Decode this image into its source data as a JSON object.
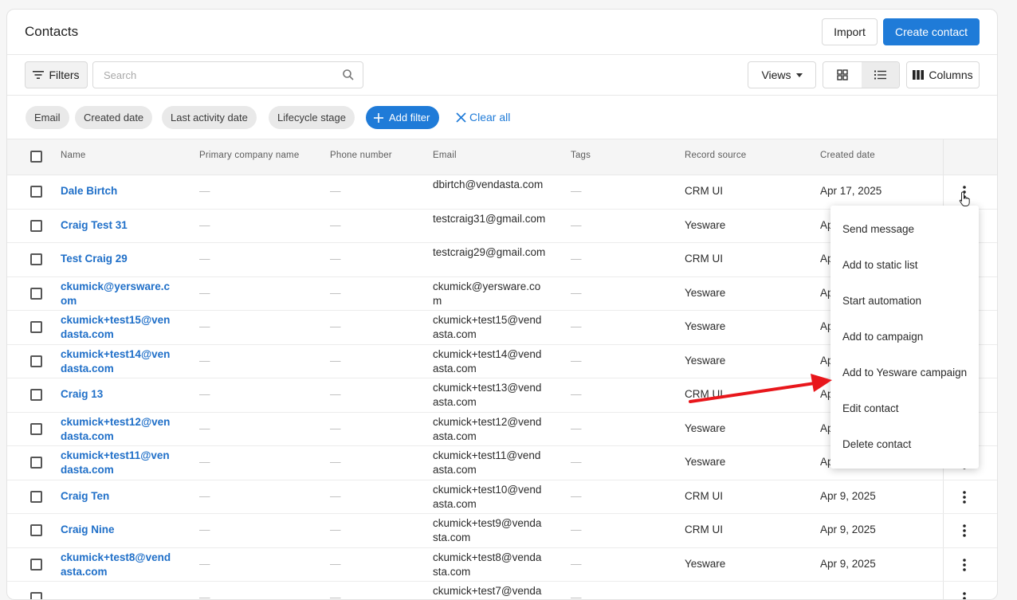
{
  "header": {
    "title": "Contacts",
    "import_label": "Import",
    "create_label": "Create contact"
  },
  "toolbar": {
    "filters_label": "Filters",
    "search_placeholder": "Search",
    "views_label": "Views",
    "columns_label": "Columns"
  },
  "chips": {
    "items": [
      "Email",
      "Created date",
      "Last activity date",
      "Lifecycle stage"
    ],
    "add_filter_label": "Add filter",
    "clear_all_label": "Clear all"
  },
  "table": {
    "columns": [
      "Name",
      "Primary company name",
      "Phone number",
      "Email",
      "Tags",
      "Record source",
      "Created date"
    ],
    "empty_value": "—",
    "rows": [
      {
        "name": "Dale Birtch",
        "email": "dbirtch@vendasta.com",
        "source": "CRM UI",
        "created": "Apr 17, 2025"
      },
      {
        "name": "Craig Test 31",
        "email": "testcraig31@gmail.com",
        "source": "Yesware",
        "created": "Ap"
      },
      {
        "name": "Test Craig 29",
        "email": "testcraig29@gmail.com",
        "source": "CRM UI",
        "created": "Ap"
      },
      {
        "name": "ckumick@yersware.com",
        "email": "ckumick@yersware.com",
        "source": "Yesware",
        "created": "Ap"
      },
      {
        "name": "ckumick+test15@vendasta.com",
        "email": "ckumick+test15@vendasta.com",
        "source": "Yesware",
        "created": "Ap"
      },
      {
        "name": "ckumick+test14@vendasta.com",
        "email": "ckumick+test14@vendasta.com",
        "source": "Yesware",
        "created": "Ap"
      },
      {
        "name": "Craig 13",
        "email": "ckumick+test13@vendasta.com",
        "source": "CRM UI",
        "created": "Ap"
      },
      {
        "name": "ckumick+test12@vendasta.com",
        "email": "ckumick+test12@vendasta.com",
        "source": "Yesware",
        "created": "Ap"
      },
      {
        "name": "ckumick+test11@vendasta.com",
        "email": "ckumick+test11@vendasta.com",
        "source": "Yesware",
        "created": "Ap"
      },
      {
        "name": "Craig Ten",
        "email": "ckumick+test10@vendasta.com",
        "source": "CRM UI",
        "created": "Apr 9, 2025"
      },
      {
        "name": "Craig Nine",
        "email": "ckumick+test9@vendasta.com",
        "source": "CRM UI",
        "created": "Apr 9, 2025"
      },
      {
        "name": "ckumick+test8@vendasta.com",
        "email": "ckumick+test8@vendasta.com",
        "source": "Yesware",
        "created": "Apr 9, 2025"
      },
      {
        "name": "",
        "email": "ckumick+test7@venda",
        "source": "",
        "created": ""
      }
    ]
  },
  "menu": {
    "items": [
      "Send message",
      "Add to static list",
      "Start automation",
      "Add to campaign",
      "Add to Yesware campaign",
      "Edit contact",
      "Delete contact"
    ]
  },
  "colors": {
    "primary": "#1f7bd8",
    "link": "#1f6fc8",
    "annotation_arrow": "#e8161b"
  }
}
